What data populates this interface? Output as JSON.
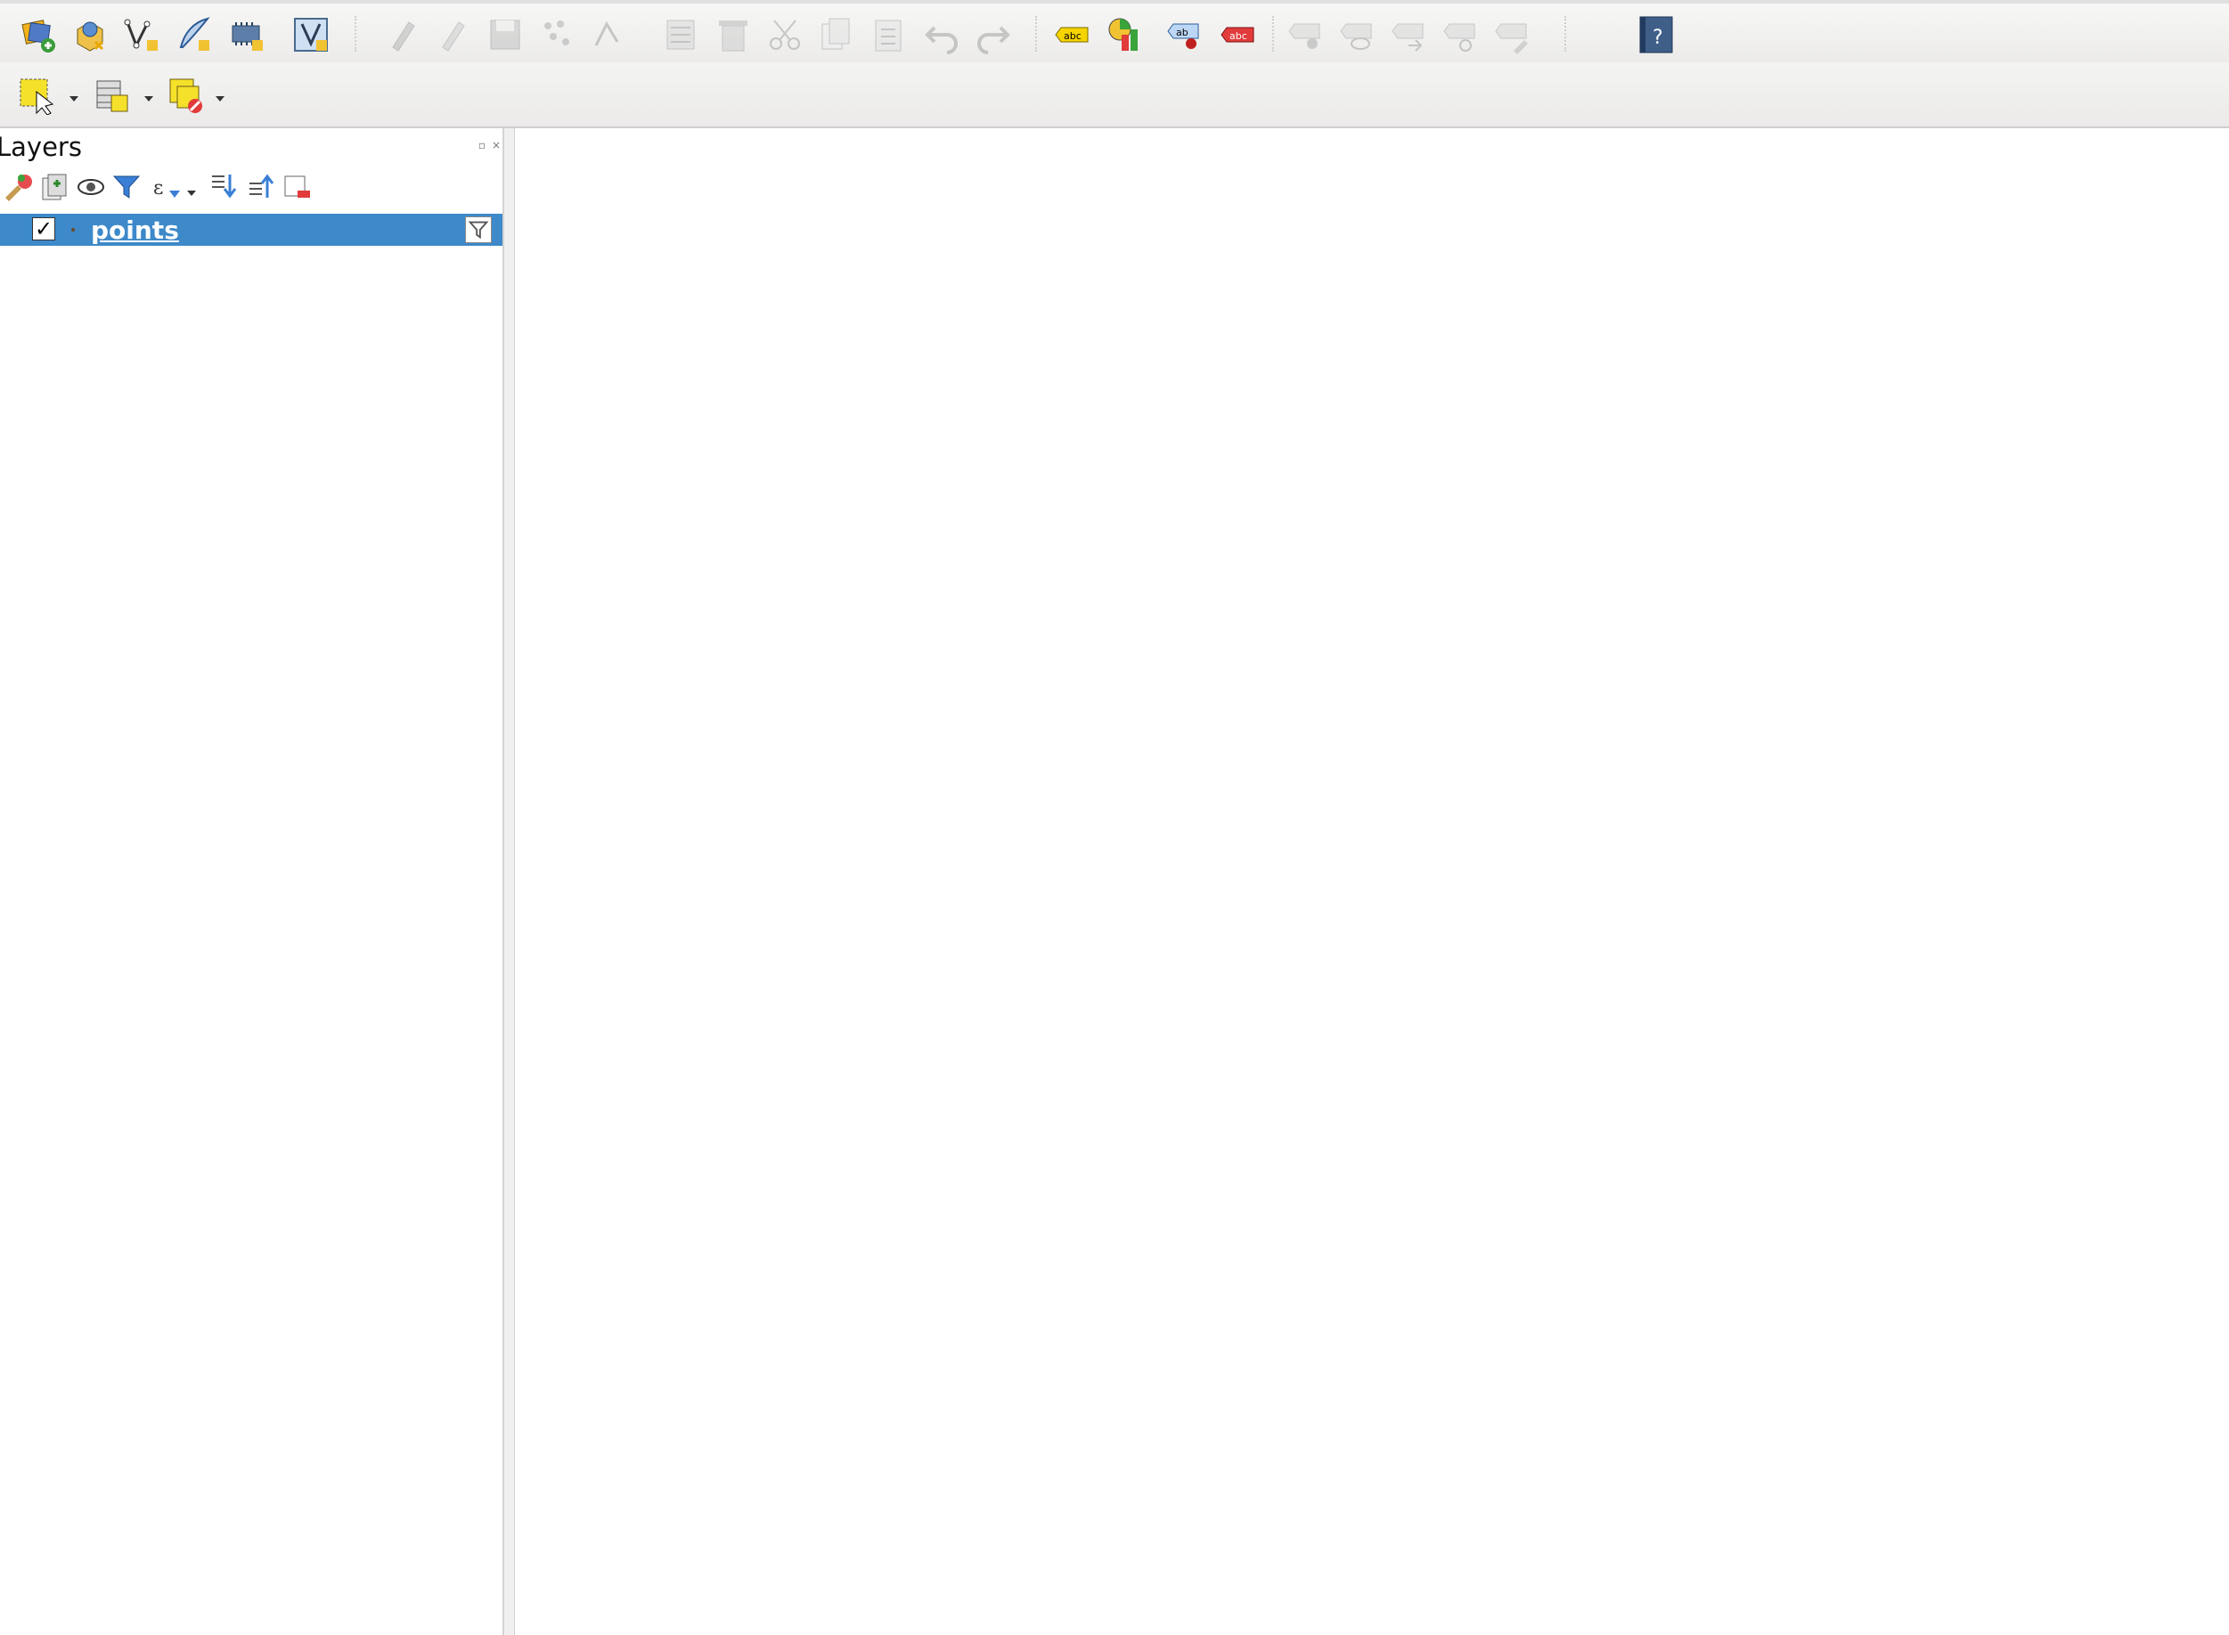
{
  "toolbar": {
    "row1": [
      {
        "name": "open-data-source-manager-icon",
        "enabled": true
      },
      {
        "name": "new-geopackage-layer-icon",
        "enabled": true
      },
      {
        "name": "new-shapefile-layer-icon",
        "enabled": true
      },
      {
        "name": "new-spatialite-layer-icon",
        "enabled": true
      },
      {
        "name": "new-temporary-layer-icon",
        "enabled": true
      },
      {
        "name": "new-virtual-layer-icon",
        "enabled": true
      },
      {
        "name": "current-edits-icon",
        "enabled": false
      },
      {
        "name": "toggle-editing-icon",
        "enabled": false
      },
      {
        "name": "save-layer-edits-icon",
        "enabled": false
      },
      {
        "name": "add-point-feature-icon",
        "enabled": false
      },
      {
        "name": "vertex-tool-icon",
        "enabled": false
      },
      {
        "name": "modify-attributes-icon",
        "enabled": false
      },
      {
        "name": "delete-selected-icon",
        "enabled": false
      },
      {
        "name": "cut-features-icon",
        "enabled": false
      },
      {
        "name": "copy-features-icon",
        "enabled": false
      },
      {
        "name": "paste-features-icon",
        "enabled": false
      },
      {
        "name": "undo-icon",
        "enabled": false
      },
      {
        "name": "redo-icon",
        "enabled": false
      },
      {
        "name": "label-toolbar-icon",
        "enabled": true
      },
      {
        "name": "diagram-options-icon",
        "enabled": true
      },
      {
        "name": "pin-labels-icon",
        "enabled": true
      },
      {
        "name": "highlight-labels-icon",
        "enabled": true
      },
      {
        "name": "move-label-icon",
        "enabled": false
      },
      {
        "name": "show-hide-labels-icon",
        "enabled": false
      },
      {
        "name": "change-label-icon",
        "enabled": false
      },
      {
        "name": "rotate-label-icon",
        "enabled": false
      },
      {
        "name": "edit-label-icon",
        "enabled": false
      },
      {
        "name": "help-icon",
        "enabled": true
      }
    ],
    "row2": [
      {
        "name": "select-features-icon"
      },
      {
        "name": "attribute-table-icon"
      },
      {
        "name": "deselect-features-icon"
      }
    ]
  },
  "layers_panel": {
    "title": "Layers",
    "tools": [
      "style-brush-icon",
      "add-group-icon",
      "manage-visibility-icon",
      "filter-legend-icon",
      "filter-expression-icon",
      "expand-all-icon",
      "collapse-all-icon",
      "remove-layer-icon"
    ],
    "layers": [
      {
        "name": "points",
        "checked": "✓",
        "selected": true,
        "has_filter": true
      }
    ]
  },
  "map": {
    "point_color": "#6b4a22",
    "layer_name": "points"
  },
  "colors": {
    "selection": "#3d89c9",
    "point": "#6b4a22",
    "label_yellow": "#f5d400",
    "label_red": "#e23b3b"
  }
}
